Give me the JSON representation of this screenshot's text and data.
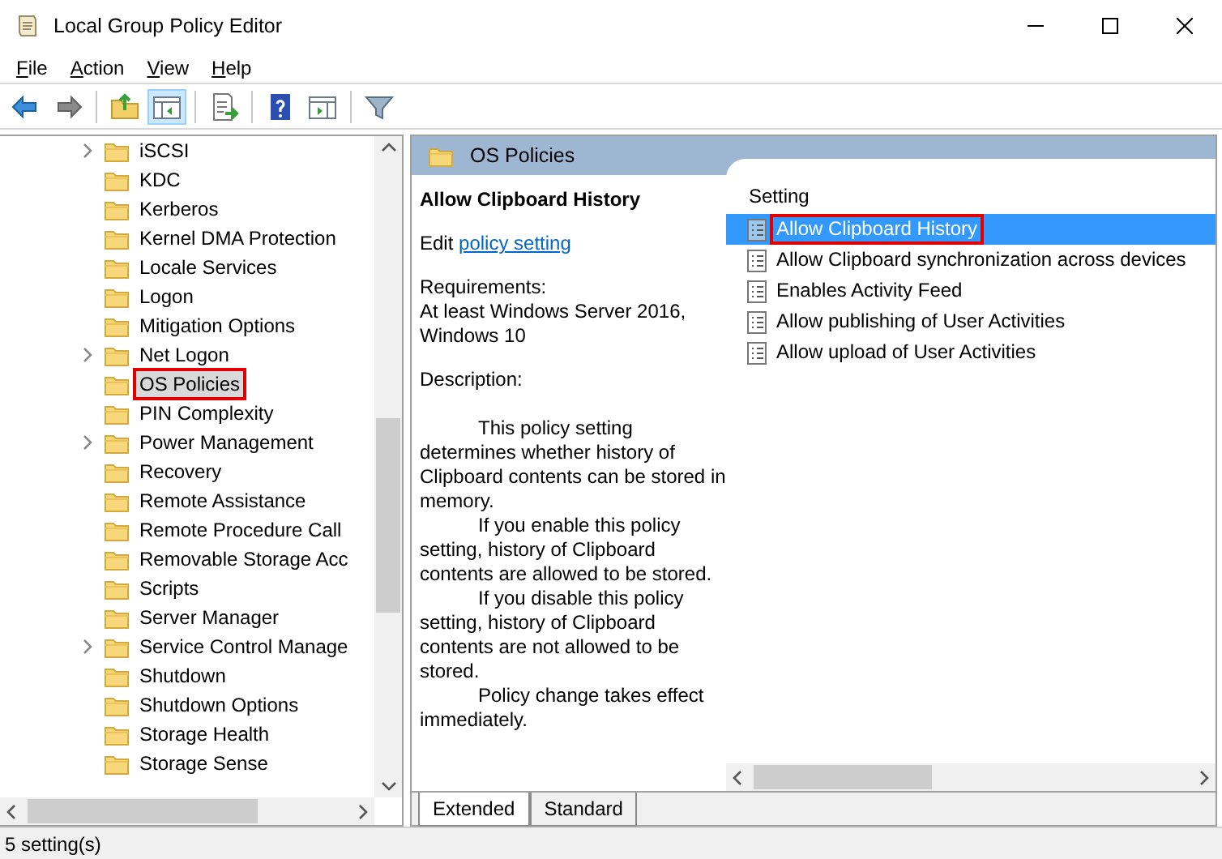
{
  "window": {
    "title": "Local Group Policy Editor"
  },
  "menu": [
    {
      "label": "File"
    },
    {
      "label": "Action"
    },
    {
      "label": "View"
    },
    {
      "label": "Help"
    }
  ],
  "toolbar": [
    {
      "kind": "back",
      "pressed": false
    },
    {
      "kind": "forward",
      "pressed": false
    },
    {
      "kind": "sep"
    },
    {
      "kind": "up",
      "pressed": false
    },
    {
      "kind": "tree",
      "pressed": true
    },
    {
      "kind": "sep"
    },
    {
      "kind": "export",
      "pressed": false
    },
    {
      "kind": "sep"
    },
    {
      "kind": "help",
      "pressed": false
    },
    {
      "kind": "panel",
      "pressed": false
    },
    {
      "kind": "sep"
    },
    {
      "kind": "filter",
      "pressed": false
    }
  ],
  "tree": [
    {
      "label": "iSCSI",
      "expandable": true,
      "selected": false,
      "highlighted": false
    },
    {
      "label": "KDC",
      "expandable": false,
      "selected": false,
      "highlighted": false
    },
    {
      "label": "Kerberos",
      "expandable": false,
      "selected": false,
      "highlighted": false
    },
    {
      "label": "Kernel DMA Protection",
      "expandable": false,
      "selected": false,
      "highlighted": false
    },
    {
      "label": "Locale Services",
      "expandable": false,
      "selected": false,
      "highlighted": false
    },
    {
      "label": "Logon",
      "expandable": false,
      "selected": false,
      "highlighted": false
    },
    {
      "label": "Mitigation Options",
      "expandable": false,
      "selected": false,
      "highlighted": false
    },
    {
      "label": "Net Logon",
      "expandable": true,
      "selected": false,
      "highlighted": false
    },
    {
      "label": "OS Policies",
      "expandable": false,
      "selected": true,
      "highlighted": true
    },
    {
      "label": "PIN Complexity",
      "expandable": false,
      "selected": false,
      "highlighted": false
    },
    {
      "label": "Power Management",
      "expandable": true,
      "selected": false,
      "highlighted": false
    },
    {
      "label": "Recovery",
      "expandable": false,
      "selected": false,
      "highlighted": false
    },
    {
      "label": "Remote Assistance",
      "expandable": false,
      "selected": false,
      "highlighted": false
    },
    {
      "label": "Remote Procedure Call",
      "expandable": false,
      "selected": false,
      "highlighted": false
    },
    {
      "label": "Removable Storage Acc",
      "expandable": false,
      "selected": false,
      "highlighted": false
    },
    {
      "label": "Scripts",
      "expandable": false,
      "selected": false,
      "highlighted": false
    },
    {
      "label": "Server Manager",
      "expandable": false,
      "selected": false,
      "highlighted": false
    },
    {
      "label": "Service Control Manage",
      "expandable": true,
      "selected": false,
      "highlighted": false
    },
    {
      "label": "Shutdown",
      "expandable": false,
      "selected": false,
      "highlighted": false
    },
    {
      "label": "Shutdown Options",
      "expandable": false,
      "selected": false,
      "highlighted": false
    },
    {
      "label": "Storage Health",
      "expandable": false,
      "selected": false,
      "highlighted": false
    },
    {
      "label": "Storage Sense",
      "expandable": false,
      "selected": false,
      "highlighted": false
    }
  ],
  "pane_header": "OS Policies",
  "detail": {
    "title": "Allow Clipboard History",
    "edit_prefix": "Edit",
    "edit_link": "policy setting",
    "requirements_label": "Requirements:",
    "requirements": "At least Windows Server 2016, Windows 10",
    "description_label": "Description:",
    "description": [
      "This policy setting determines whether history of Clipboard contents can be stored in memory.",
      "If you enable this policy setting, history of Clipboard contents are allowed to be stored.",
      "If you disable this policy setting, history of Clipboard contents are not allowed to be stored.",
      "Policy change takes effect immediately."
    ]
  },
  "settings": {
    "column": "Setting",
    "items": [
      {
        "label": "Allow Clipboard History",
        "selected": true,
        "highlighted": true
      },
      {
        "label": "Allow Clipboard synchronization across devices",
        "selected": false,
        "highlighted": false
      },
      {
        "label": "Enables Activity Feed",
        "selected": false,
        "highlighted": false
      },
      {
        "label": "Allow publishing of User Activities",
        "selected": false,
        "highlighted": false
      },
      {
        "label": "Allow upload of User Activities",
        "selected": false,
        "highlighted": false
      }
    ]
  },
  "tabs": [
    {
      "label": "Extended",
      "selected": true
    },
    {
      "label": "Standard",
      "selected": false
    }
  ],
  "status_bar": "5 setting(s)"
}
